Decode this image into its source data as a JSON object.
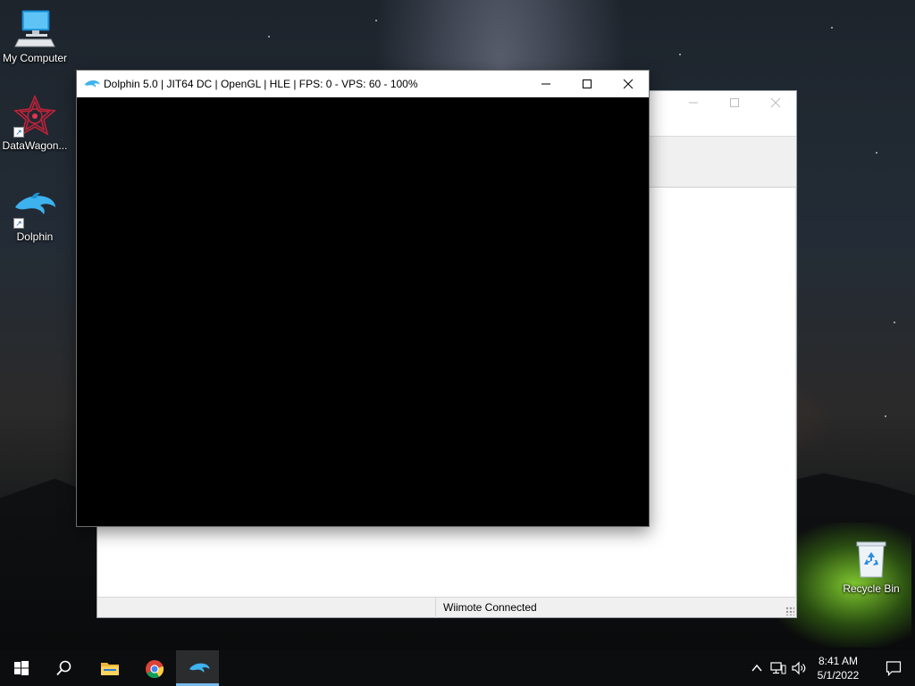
{
  "desktop": {
    "icons": [
      {
        "label": "My Computer",
        "icon": "computer-icon"
      },
      {
        "label": "DataWagon...",
        "icon": "datawagon-icon"
      },
      {
        "label": "Dolphin",
        "icon": "dolphin-icon"
      },
      {
        "label": "Recycle Bin",
        "icon": "recycle-bin-icon"
      }
    ]
  },
  "render_window": {
    "title": "Dolphin 5.0 | JIT64 DC | OpenGL | HLE | FPS: 0 - VPS: 60 - 100%",
    "minimize": "minimize-icon",
    "maximize": "maximize-icon",
    "close": "close-icon"
  },
  "main_window": {
    "status_text": "Wiimote Connected"
  },
  "taskbar": {
    "items": [
      "start-icon",
      "search-icon",
      "file-explorer-icon",
      "chrome-icon",
      "dolphin-icon"
    ],
    "active_item": "dolphin-icon",
    "accent_color": "#76b9ed"
  },
  "tray": {
    "icons": [
      "chevron-up-icon",
      "network-icon",
      "volume-icon",
      "notification-icon"
    ],
    "time": "8:41 AM",
    "date": "5/1/2022"
  }
}
